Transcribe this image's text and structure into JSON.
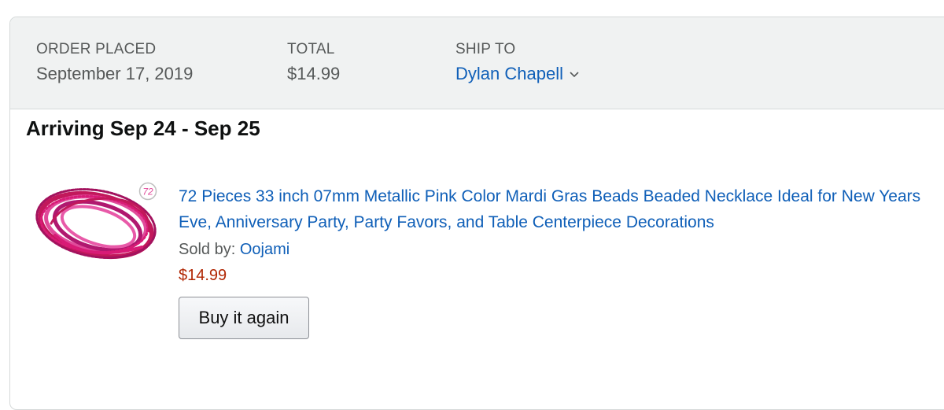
{
  "header": {
    "order_placed_label": "ORDER PLACED",
    "order_placed_value": "September 17, 2019",
    "total_label": "TOTAL",
    "total_value": "$14.99",
    "ship_to_label": "SHIP TO",
    "ship_to_name": "Dylan Chapell"
  },
  "shipment": {
    "arrival": "Arriving Sep 24 - Sep 25"
  },
  "item": {
    "quantity_badge": "72",
    "title": "72 Pieces 33 inch 07mm Metallic Pink Color Mardi Gras Beads Beaded Necklace Ideal for New Years Eve, Anniversary Party, Party Favors, and Table Centerpiece Decorations",
    "sold_by_label": "Sold by: ",
    "seller": "Oojami",
    "price": "$14.99",
    "buy_again_label": "Buy it again",
    "image_icon": "pink-bead-necklace-image"
  },
  "colors": {
    "header_bg": "#f0f2f2",
    "link": "#0f5fb8",
    "price": "#b12704",
    "muted_text": "#565959"
  }
}
